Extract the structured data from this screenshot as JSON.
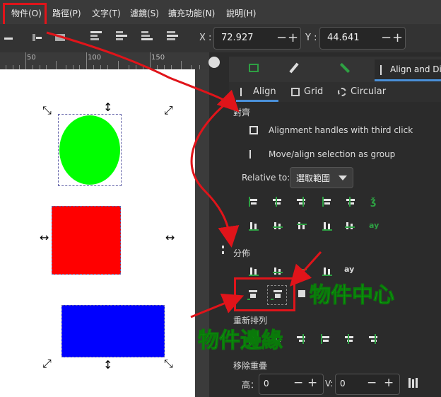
{
  "menu": {
    "items": [
      "物件(O)",
      "路徑(P)",
      "文字(T)",
      "濾鏡(S)",
      "擴充功能(N)",
      "說明(H)"
    ]
  },
  "toolbar": {
    "x_label": "X :",
    "x_value": "72.927",
    "y_label": "Y :",
    "y_value": "44.641"
  },
  "ruler": {
    "labels": [
      "50",
      "100",
      "150"
    ]
  },
  "panel": {
    "top_tabs": [
      {
        "icon": "image-icon"
      },
      {
        "icon": "pen-icon"
      },
      {
        "icon": "wrench-icon"
      },
      {
        "label": "Align and Di"
      }
    ],
    "sub_tabs": [
      "Align",
      "Grid",
      "Circular"
    ],
    "align_section": "對齊",
    "options": [
      "Alignment handles with third click",
      "Move/align selection as group"
    ],
    "relative_to_label": "Relative to:",
    "relative_to_value": "選取範圍",
    "distribute_section": "分佈",
    "rearrange_section": "重新排列",
    "remove_overlap_section": "移除重疊",
    "h_label": "高：",
    "h_value": "0",
    "v_label": "V:",
    "v_value": "0",
    "icon_glyphs": {
      "text_align": "ǯ",
      "text_dist": "ay"
    }
  },
  "annotations": {
    "object_center": "物件中心",
    "object_edge": "物件邊緣"
  },
  "colors": {
    "highlight_red": "#e0141a",
    "annotation_green": "#14d414",
    "shape_green": "#00ff00",
    "shape_red": "#ff0000",
    "shape_blue": "#0000ff",
    "accent_blue": "#4a90d9"
  }
}
